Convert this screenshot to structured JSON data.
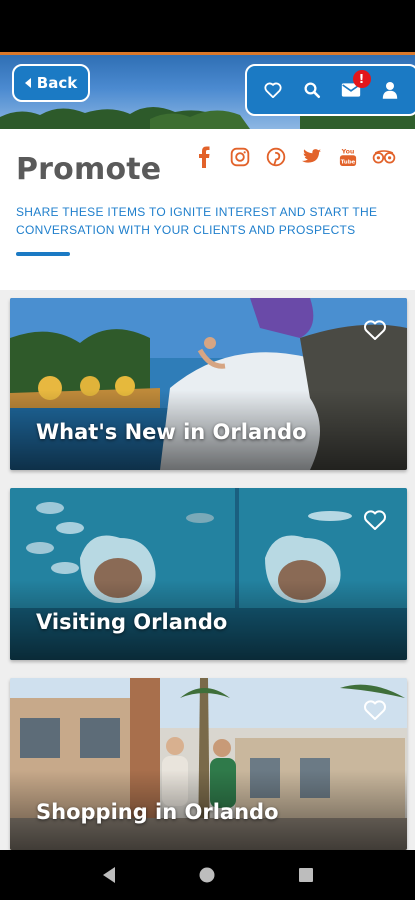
{
  "colors": {
    "accent_orange": "#d9782b",
    "brand_blue": "#1b7ac4",
    "subtitle_blue": "#1f7fcc",
    "title_gray": "#5a5a5a",
    "badge_red": "#e3161b"
  },
  "header": {
    "back_label": "Back",
    "toolbar": {
      "icons": [
        "heart-icon",
        "search-icon",
        "mail-icon",
        "user-icon"
      ],
      "mail_badge": "!"
    }
  },
  "page": {
    "title": "Promote",
    "subtitle": "SHARE THESE ITEMS TO IGNITE INTEREST AND START THE CONVERSATION WITH YOUR CLIENTS AND PROSPECTS",
    "social_icons": [
      "facebook-icon",
      "instagram-icon",
      "pinterest-icon",
      "twitter-icon",
      "youtube-icon",
      "tripadvisor-icon"
    ]
  },
  "cards": [
    {
      "label": "What's New in Orlando",
      "icon": "heart-outline-icon"
    },
    {
      "label": "Visiting Orlando",
      "icon": "heart-outline-icon"
    },
    {
      "label": "Shopping in Orlando",
      "icon": "heart-outline-icon"
    }
  ],
  "system_nav": {
    "icons": [
      "back-triangle-icon",
      "home-circle-icon",
      "recents-square-icon"
    ]
  }
}
